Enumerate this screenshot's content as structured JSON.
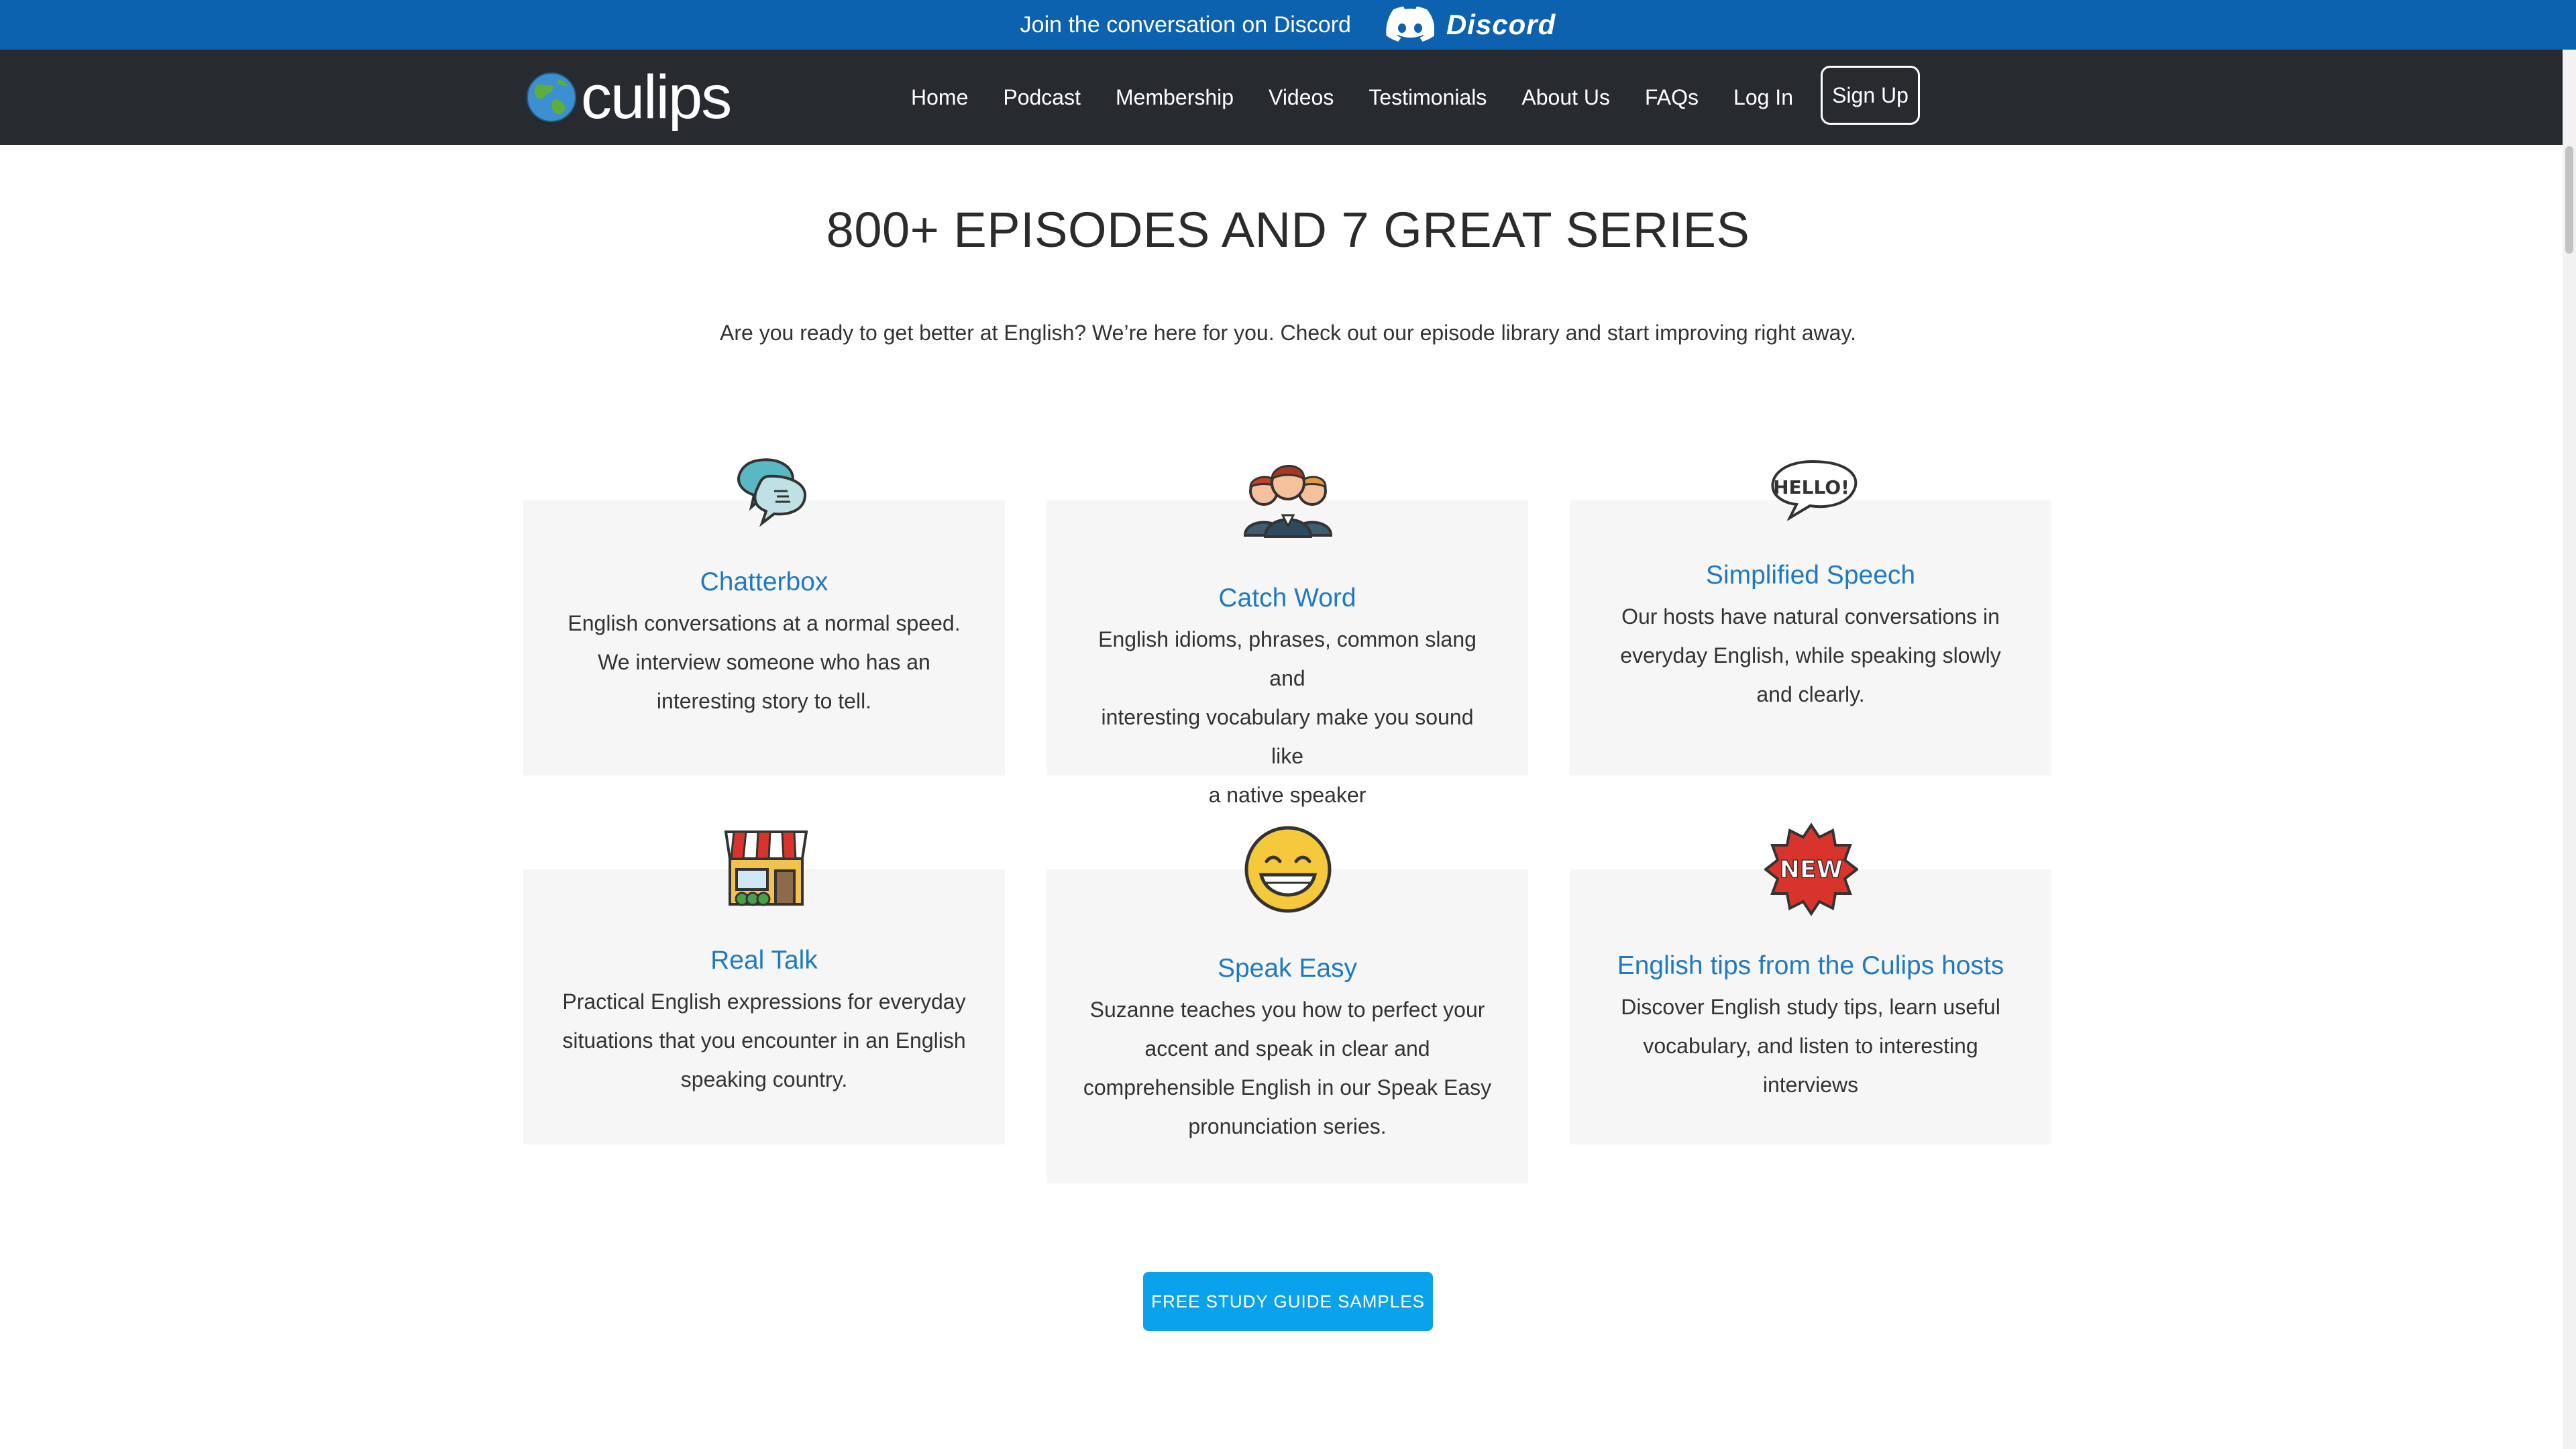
{
  "banner": {
    "message": "Join the conversation on Discord",
    "discord_word": "Discord",
    "background": "#0d62b0"
  },
  "nav": {
    "logo_text": "culips",
    "items": [
      "Home",
      "Podcast",
      "Membership",
      "Videos",
      "Testimonials",
      "About Us",
      "FAQs",
      "Log In"
    ],
    "signup_label": "Sign Up",
    "background": "#272b30"
  },
  "main": {
    "title": "800+ EPISODES AND 7 GREAT SERIES",
    "intro": "Are you ready to get better at English? We’re here for you. Check out our episode library and start improving right away.",
    "cards": [
      {
        "title": "Chatterbox",
        "icon": "speech-bubbles-icon",
        "desc": [
          "English conversations at a normal speed.",
          "We interview someone who has an",
          "interesting story to tell."
        ]
      },
      {
        "title": "Catch Word",
        "icon": "people-group-icon",
        "desc": [
          "English idioms, phrases, common slang and",
          "interesting vocabulary make you sound like",
          "a native speaker"
        ]
      },
      {
        "title": "Simplified Speech",
        "icon": "hello-bubble-icon",
        "desc": [
          "Our hosts have natural conversations in",
          "everyday English, while speaking slowly",
          "and clearly."
        ]
      },
      {
        "title": "Real Talk",
        "icon": "storefront-icon",
        "desc": [
          "Practical English expressions for everyday",
          "situations that you encounter in an English",
          "speaking country."
        ]
      },
      {
        "title": "Speak Easy",
        "icon": "smiling-face-icon",
        "desc": [
          "Suzanne teaches you how to perfect your",
          "accent and speak in clear and",
          "comprehensible English in our Speak Easy",
          "pronunciation series."
        ]
      },
      {
        "title": "English tips from the Culips hosts",
        "icon": "new-badge-icon",
        "desc": [
          "Discover English study tips, learn useful",
          "vocabulary, and listen to interesting",
          "interviews"
        ]
      }
    ],
    "cta_label": "FREE STUDY GUIDE SAMPLES",
    "accent": "#1f7ac1",
    "cta_color": "#0aa2ea"
  }
}
